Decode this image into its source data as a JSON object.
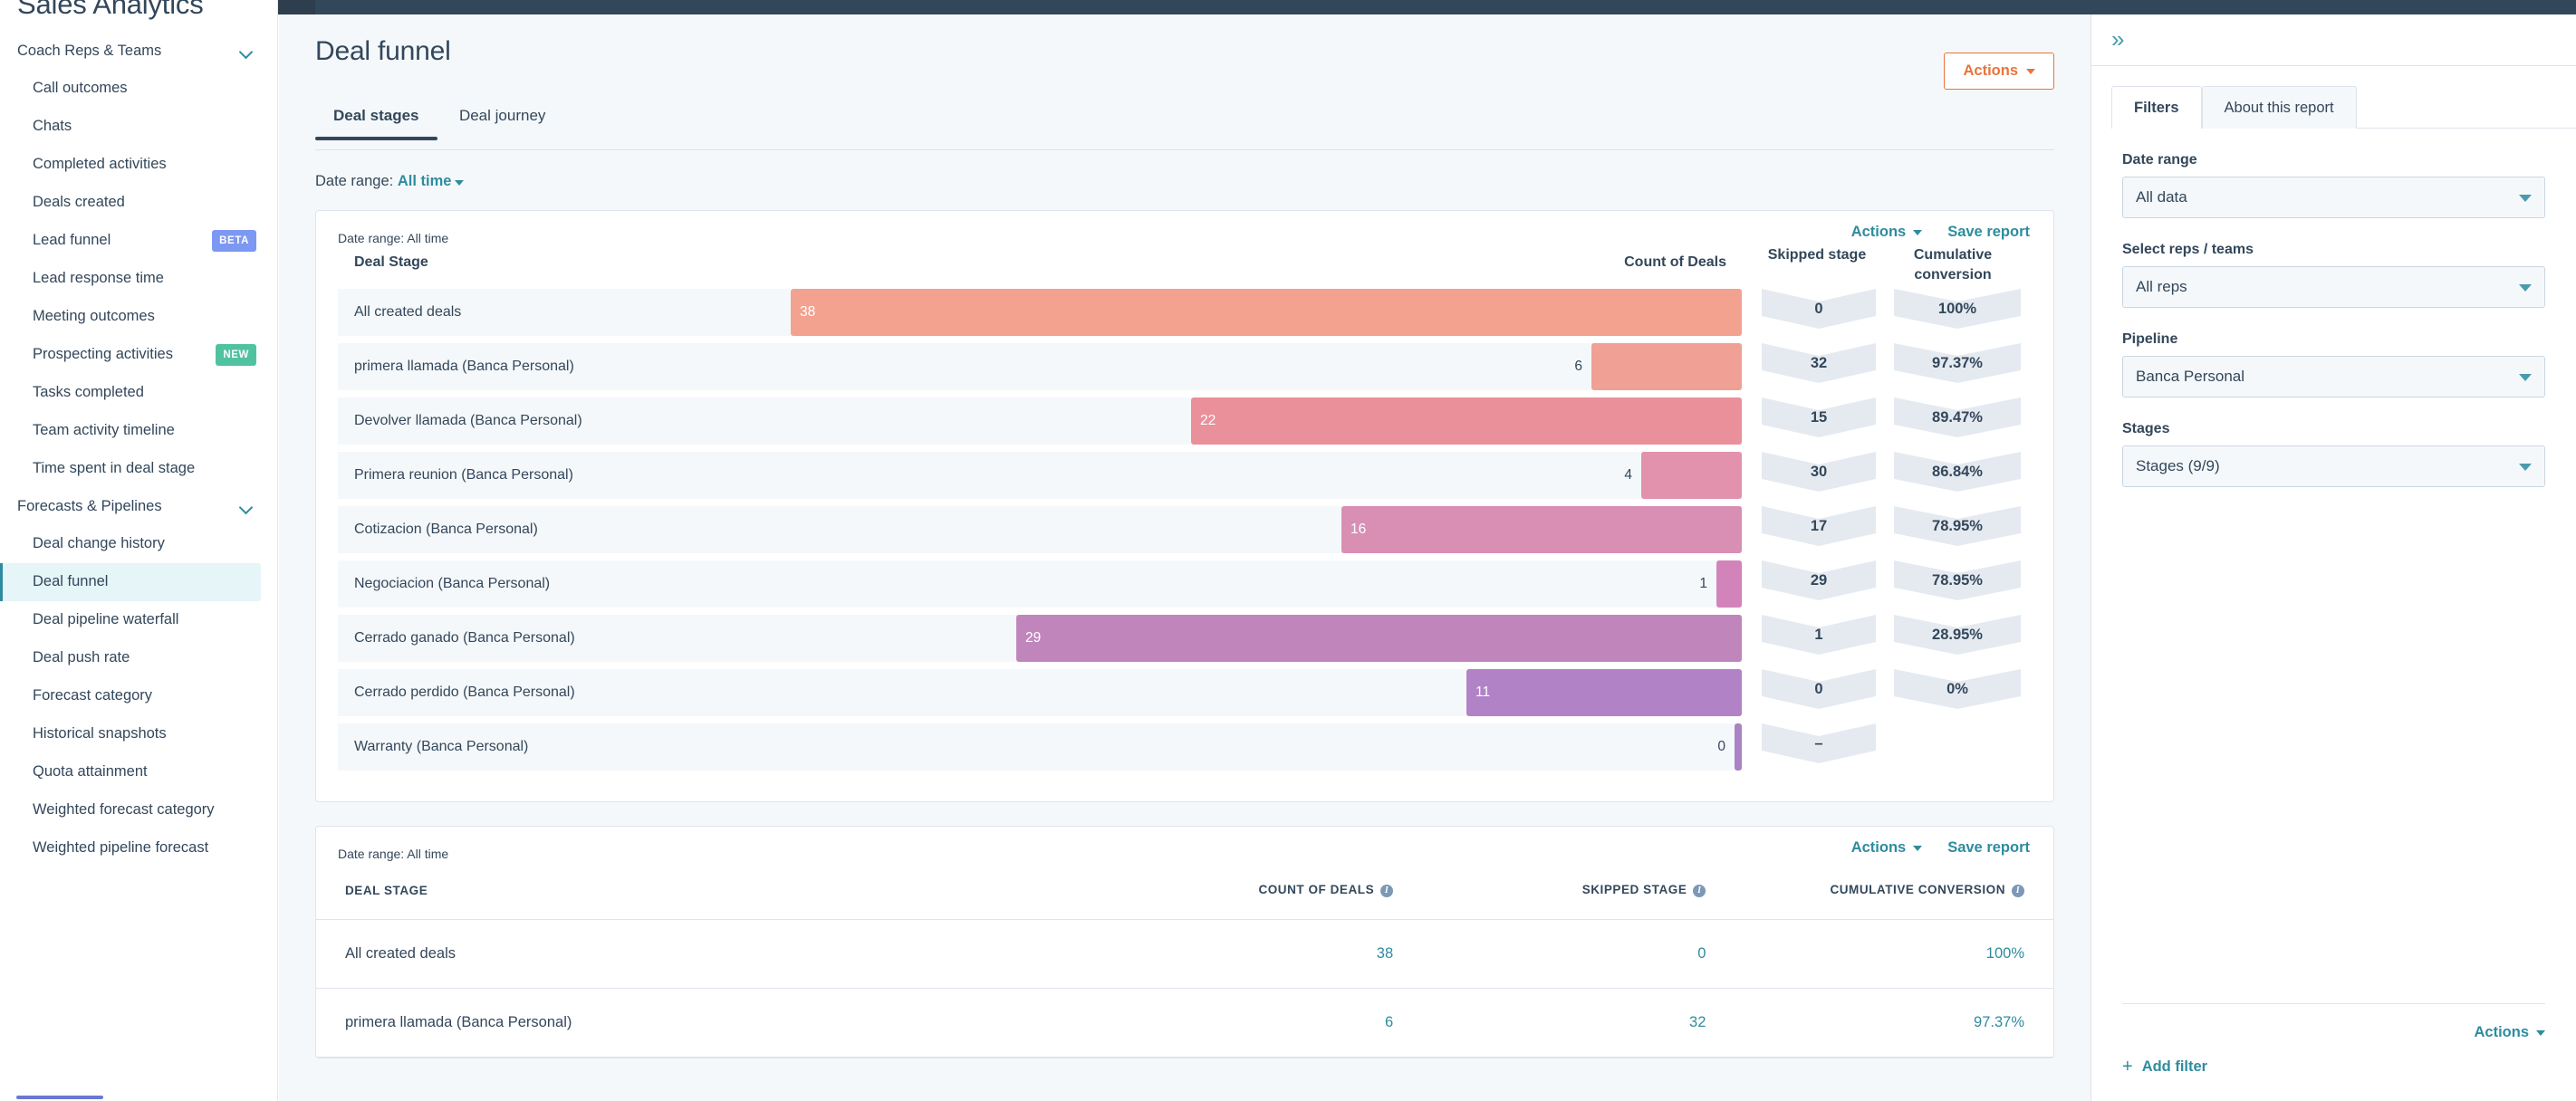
{
  "sidebar": {
    "title": "Sales Analytics",
    "groups": [
      {
        "label": "Coach Reps & Teams",
        "items": [
          {
            "label": "Call outcomes"
          },
          {
            "label": "Chats"
          },
          {
            "label": "Completed activities"
          },
          {
            "label": "Deals created"
          },
          {
            "label": "Lead funnel",
            "badge": "BETA",
            "badge_kind": "beta"
          },
          {
            "label": "Lead response time"
          },
          {
            "label": "Meeting outcomes"
          },
          {
            "label": "Prospecting activities",
            "badge": "NEW",
            "badge_kind": "new"
          },
          {
            "label": "Tasks completed"
          },
          {
            "label": "Team activity timeline"
          },
          {
            "label": "Time spent in deal stage"
          }
        ]
      },
      {
        "label": "Forecasts & Pipelines",
        "items": [
          {
            "label": "Deal change history"
          },
          {
            "label": "Deal funnel",
            "active": true
          },
          {
            "label": "Deal pipeline waterfall"
          },
          {
            "label": "Deal push rate"
          },
          {
            "label": "Forecast category"
          },
          {
            "label": "Historical snapshots"
          },
          {
            "label": "Quota attainment"
          },
          {
            "label": "Weighted forecast category"
          },
          {
            "label": "Weighted pipeline forecast"
          }
        ]
      }
    ]
  },
  "header": {
    "title": "Deal funnel",
    "actions_button": "Actions",
    "tabs": [
      {
        "label": "Deal stages",
        "active": true
      },
      {
        "label": "Deal journey",
        "active": false
      }
    ],
    "date_range_prefix": "Date range:",
    "date_range_value": "All time"
  },
  "chart_card": {
    "actions_label": "Actions",
    "save_report_label": "Save report",
    "date_range_note": "Date range: All time",
    "columns": {
      "stage": "Deal Stage",
      "count": "Count of Deals",
      "skipped": "Skipped stage",
      "conversion": "Cumulative conversion"
    }
  },
  "table_card": {
    "actions_label": "Actions",
    "save_report_label": "Save report",
    "date_range_note": "Date range: All time",
    "headers": [
      "DEAL STAGE",
      "COUNT OF DEALS",
      "SKIPPED STAGE",
      "CUMULATIVE CONVERSION"
    ],
    "rows": [
      {
        "stage": "All created deals",
        "count": "38",
        "skipped": "0",
        "conversion": "100%"
      },
      {
        "stage": "primera llamada (Banca Personal)",
        "count": "6",
        "skipped": "32",
        "conversion": "97.37%"
      }
    ]
  },
  "right_panel": {
    "collapse_icon": "double-chevron-right-icon",
    "tabs": [
      {
        "label": "Filters",
        "active": true
      },
      {
        "label": "About this report",
        "active": false
      }
    ],
    "fields": [
      {
        "label": "Date range",
        "value": "All data"
      },
      {
        "label": "Select reps / teams",
        "value": "All reps"
      },
      {
        "label": "Pipeline",
        "value": "Banca Personal"
      },
      {
        "label": "Stages",
        "value": "Stages (9/9)"
      }
    ],
    "actions_label": "Actions",
    "add_filter_label": "Add filter"
  },
  "chart_data": {
    "type": "bar",
    "title": "Deal funnel — Deal stages",
    "xlabel": "Count of Deals",
    "ylabel": "Deal Stage",
    "xlim": [
      0,
      38
    ],
    "grid": false,
    "legend": "none",
    "orientation": "horizontal-right-aligned",
    "categories": [
      "All created deals",
      "primera llamada (Banca Personal)",
      "Devolver llamada (Banca Personal)",
      "Primera reunion (Banca Personal)",
      "Cotizacion (Banca Personal)",
      "Negociacion (Banca Personal)",
      "Cerrado ganado (Banca Personal)",
      "Cerrado perdido (Banca Personal)",
      "Warranty (Banca Personal)"
    ],
    "values": [
      38,
      6,
      22,
      4,
      16,
      1,
      29,
      11,
      0
    ],
    "bar_colors": [
      "#F2A28E",
      "#F0A094",
      "#E9909B",
      "#E292AD",
      "#D98FB4",
      "#D283B9",
      "#C086BC",
      "#B182C6",
      "#A983C4"
    ],
    "label_inside": [
      true,
      false,
      true,
      false,
      true,
      false,
      true,
      true,
      false
    ],
    "series": [
      {
        "name": "Skipped stage",
        "values": [
          "0",
          "32",
          "15",
          "30",
          "17",
          "29",
          "1",
          "0",
          "–"
        ]
      },
      {
        "name": "Cumulative conversion",
        "values": [
          "100%",
          "97.37%",
          "89.47%",
          "86.84%",
          "78.95%",
          "78.95%",
          "28.95%",
          "0%",
          ""
        ]
      }
    ]
  },
  "colors": {
    "topbar": "#33475B",
    "accent_teal": "#2E8C9E",
    "accent_orange": "#E8743B",
    "bg": "#F5F8FA"
  }
}
